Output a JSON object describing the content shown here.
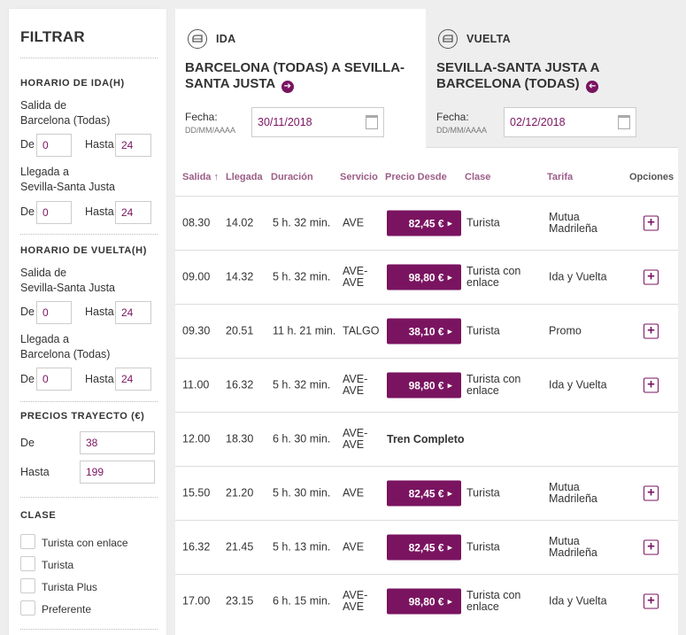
{
  "colors": {
    "accent": "#7a1460",
    "header_text": "#9b5d87"
  },
  "filter": {
    "title": "FILTRAR",
    "horario_ida": {
      "title": "HORARIO DE IDA(H)",
      "salida_label": "Salida de\nBarcelona (Todas)",
      "salida_de": "0",
      "salida_hasta": "24",
      "llegada_label": "Llegada a\nSevilla-Santa Justa",
      "llegada_de": "0",
      "llegada_hasta": "24"
    },
    "horario_vuelta": {
      "title": "HORARIO DE VUELTA(H)",
      "salida_label": "Salida de\nSevilla-Santa Justa",
      "salida_de": "0",
      "salida_hasta": "24",
      "llegada_label": "Llegada a\nBarcelona (Todas)",
      "llegada_de": "0",
      "llegada_hasta": "24"
    },
    "de_label": "De",
    "hasta_label": "Hasta",
    "precios": {
      "title": "PRECIOS TRAYECTO (€)",
      "de_label": "De",
      "de_value": "38",
      "hasta_label": "Hasta",
      "hasta_value": "199"
    },
    "clase": {
      "title": "CLASE",
      "options": [
        "Turista con enlace",
        "Turista",
        "Turista Plus",
        "Preferente"
      ]
    }
  },
  "tabs": {
    "ida": {
      "label": "IDA",
      "route": "BARCELONA (TODAS) A SEVILLA-SANTA JUSTA",
      "fecha_label": "Fecha:",
      "fecha_format": "DD/MM/AAAA",
      "date": "30/11/2018"
    },
    "vuelta": {
      "label": "VUELTA",
      "route": "SEVILLA-SANTA JUSTA A BARCELONA (TODAS)",
      "fecha_label": "Fecha:",
      "fecha_format": "DD/MM/AAAA",
      "date": "02/12/2018"
    }
  },
  "table": {
    "headers": [
      "Salida ↑",
      "Llegada",
      "Duración",
      "Servicio",
      "Precio Desde",
      "Clase",
      "Tarifa",
      "Opciones"
    ],
    "rows": [
      {
        "salida": "08.30",
        "llegada": "14.02",
        "duracion": "5 h. 32 min.",
        "servicio": "AVE",
        "precio": "82,45 €",
        "clase": "Turista",
        "tarifa": "Mutua\nMadrileña"
      },
      {
        "salida": "09.00",
        "llegada": "14.32",
        "duracion": "5 h. 32 min.",
        "servicio": "AVE-\nAVE",
        "precio": "98,80 €",
        "clase": "Turista con\nenlace",
        "tarifa": "Ida y Vuelta"
      },
      {
        "salida": "09.30",
        "llegada": "20.51",
        "duracion": "11 h. 21 min.",
        "servicio": "TALGO",
        "precio": "38,10 €",
        "clase": "Turista",
        "tarifa": "Promo"
      },
      {
        "salida": "11.00",
        "llegada": "16.32",
        "duracion": "5 h. 32 min.",
        "servicio": "AVE-\nAVE",
        "precio": "98,80 €",
        "clase": "Turista con\nenlace",
        "tarifa": "Ida y Vuelta"
      },
      {
        "salida": "12.00",
        "llegada": "18.30",
        "duracion": "6 h. 30 min.",
        "servicio": "AVE-\nAVE",
        "status": "Tren Completo"
      },
      {
        "salida": "15.50",
        "llegada": "21.20",
        "duracion": "5 h. 30 min.",
        "servicio": "AVE",
        "precio": "82,45 €",
        "clase": "Turista",
        "tarifa": "Mutua\nMadrileña"
      },
      {
        "salida": "16.32",
        "llegada": "21.45",
        "duracion": "5 h. 13 min.",
        "servicio": "AVE",
        "precio": "82,45 €",
        "clase": "Turista",
        "tarifa": "Mutua\nMadrileña"
      },
      {
        "salida": "17.00",
        "llegada": "23.15",
        "duracion": "6 h. 15 min.",
        "servicio": "AVE-\nAVE",
        "precio": "98,80 €",
        "clase": "Turista con\nenlace",
        "tarifa": "Ida y Vuelta"
      }
    ]
  }
}
